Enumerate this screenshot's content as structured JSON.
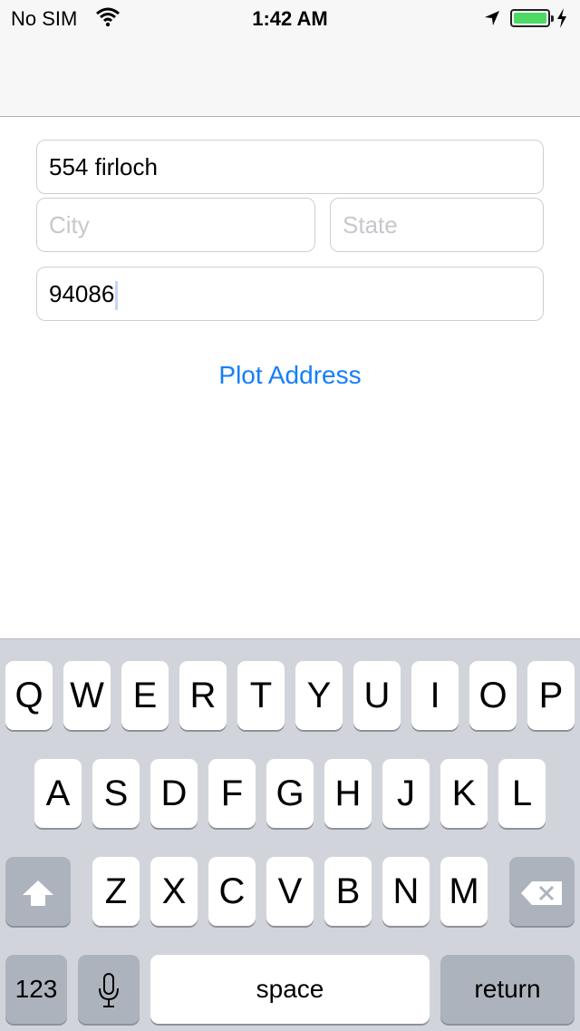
{
  "status_bar": {
    "carrier": "No SIM",
    "time": "1:42 AM",
    "battery_color": "#4cd964"
  },
  "form": {
    "street_value": "554 firloch",
    "city_placeholder": "City",
    "state_placeholder": "State",
    "zip_value": "94086",
    "plot_button": "Plot Address"
  },
  "keyboard": {
    "row1": [
      "Q",
      "W",
      "E",
      "R",
      "T",
      "Y",
      "U",
      "I",
      "O",
      "P"
    ],
    "row2": [
      "A",
      "S",
      "D",
      "F",
      "G",
      "H",
      "J",
      "K",
      "L"
    ],
    "row3": [
      "Z",
      "X",
      "C",
      "V",
      "B",
      "N",
      "M"
    ],
    "numbers_key": "123",
    "space_key": "space",
    "return_key": "return",
    "accent_color": "#157efb"
  }
}
